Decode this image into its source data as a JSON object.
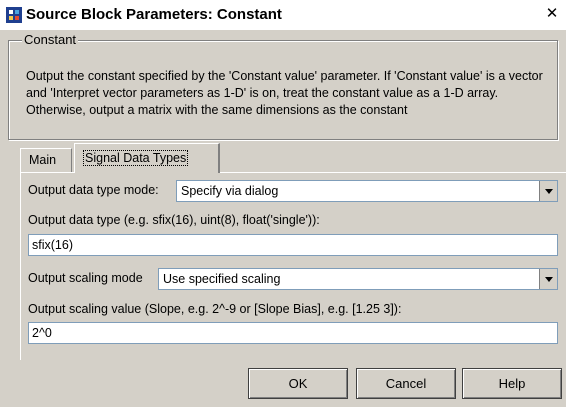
{
  "window": {
    "title": "Source Block Parameters: Constant",
    "close_glyph": "✕"
  },
  "group": {
    "label": "Constant",
    "description": "Output the constant specified by the 'Constant value' parameter. If 'Constant value' is a vector and 'Interpret vector parameters as 1-D' is on, treat the constant value as a 1-D array. Otherwise, output a matrix with the same dimensions as the constant"
  },
  "tabs": [
    {
      "label": "Main",
      "active": false
    },
    {
      "label": "Signal Data Types",
      "active": true
    }
  ],
  "fields": {
    "output_mode_label": "Output data type mode:",
    "output_mode_value": "Specify via dialog",
    "output_type_label": "Output data type (e.g. sfix(16), uint(8), float('single')):",
    "output_type_value": "sfix(16)",
    "scaling_mode_label": "Output scaling mode",
    "scaling_mode_value": "Use specified scaling",
    "scaling_value_label": "Output scaling value (Slope, e.g. 2^-9 or [Slope Bias], e.g. [1.25 3]):",
    "scaling_value_value": "2^0"
  },
  "buttons": {
    "ok": "OK",
    "cancel": "Cancel",
    "help": "Help"
  },
  "icons": {
    "app_icon": "simulink-block-icon",
    "close": "close-icon",
    "dropdown": "chevron-down-icon"
  }
}
